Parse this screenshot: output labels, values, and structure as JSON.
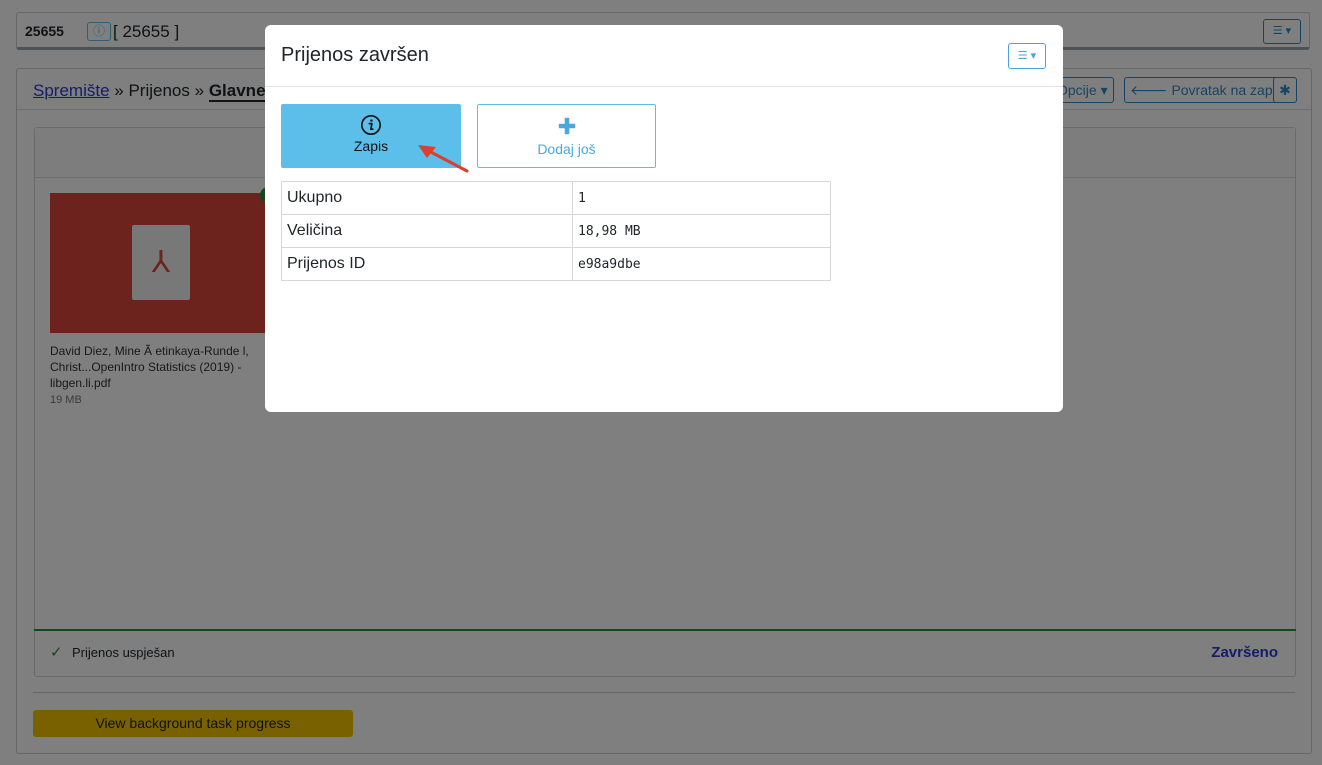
{
  "topbar": {
    "record_id": "25655",
    "info_icon": "info-circle-icon",
    "record_title": "[ 25655 ]",
    "menu_icon": "menu-icon"
  },
  "panel": {
    "breadcrumb": {
      "root": "Spremište",
      "sep1": "»",
      "step": "Prijenos",
      "sep2": "»",
      "current": "Glavne c"
    },
    "options_label": "Opcije",
    "back_label": "Povratak na zapis",
    "bug_icon": "bug-icon",
    "file": {
      "name": "David Diez, Mine Ã   etinkaya-Runde l, Christ...OpenIntro Statistics (2019) - libgen.li.pdf",
      "size": "19 MB",
      "icon": "pdf-icon"
    },
    "status_text": "Prijenos uspješan",
    "done_label": "Završeno",
    "bg_task_label": "View background task progress"
  },
  "modal": {
    "title": "Prijenos završen",
    "menu_icon": "menu-icon",
    "tiles": [
      {
        "label": "Zapis",
        "icon": "info-circle-icon"
      },
      {
        "label": "Dodaj još",
        "icon": "plus-icon"
      }
    ],
    "table": [
      {
        "key": "Ukupno",
        "value": "1"
      },
      {
        "key": "Veličina",
        "value": "18,98 MB"
      },
      {
        "key": "Prijenos ID",
        "value": "e98a9dbe"
      }
    ]
  },
  "colors": {
    "accent": "#5bbfea",
    "link": "#2b39d9",
    "success": "#2e8b3d",
    "pdf_red": "#d9463b",
    "warning_button": "#f2c200",
    "annotation_arrow": "#d9412b"
  }
}
